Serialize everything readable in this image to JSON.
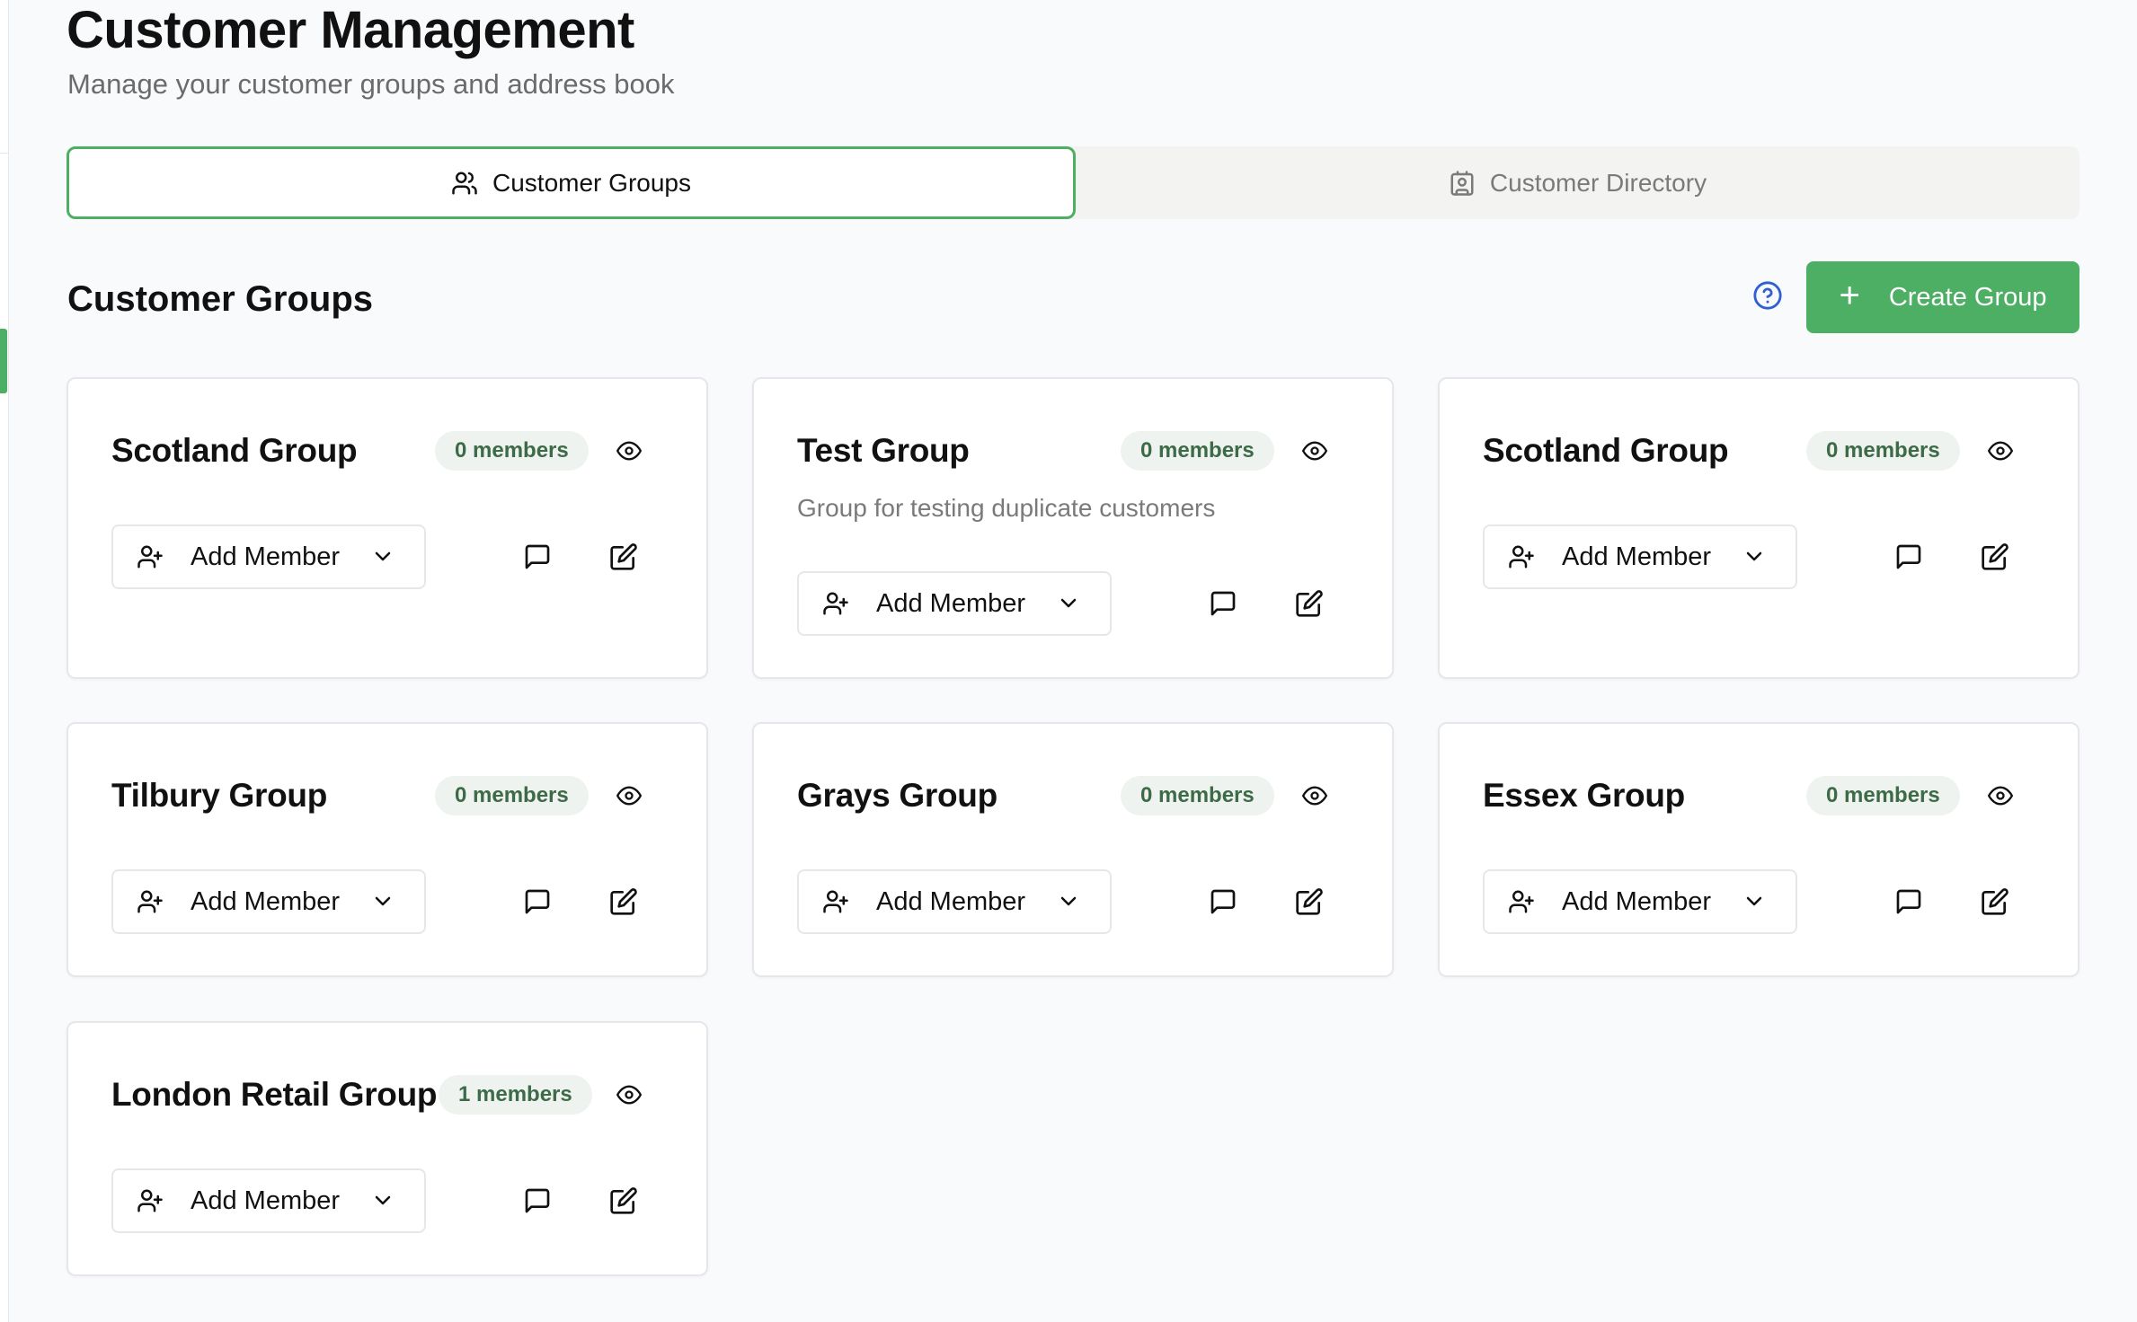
{
  "page": {
    "title": "Customer Management",
    "subtitle": "Manage your customer groups and address book"
  },
  "tabs": [
    {
      "label": "Customer Groups",
      "icon": "users-icon",
      "active": true
    },
    {
      "label": "Customer Directory",
      "icon": "contact-icon",
      "active": false
    }
  ],
  "section": {
    "title": "Customer Groups",
    "help_icon": "help-circle-icon",
    "create_button": "Create Group"
  },
  "groups": [
    {
      "name": "Scotland Group",
      "members": "0 members",
      "description": "",
      "add_member": "Add Member"
    },
    {
      "name": "Test Group",
      "members": "0 members",
      "description": "Group for testing duplicate customers",
      "add_member": "Add Member"
    },
    {
      "name": "Scotland Group",
      "members": "0 members",
      "description": "",
      "add_member": "Add Member"
    },
    {
      "name": "Tilbury Group",
      "members": "0 members",
      "description": "",
      "add_member": "Add Member"
    },
    {
      "name": "Grays Group",
      "members": "0 members",
      "description": "",
      "add_member": "Add Member"
    },
    {
      "name": "Essex Group",
      "members": "0 members",
      "description": "",
      "add_member": "Add Member"
    },
    {
      "name": "London Retail Group",
      "members": "1 members",
      "description": "",
      "add_member": "Add Member"
    }
  ],
  "colors": {
    "accent": "#4caf64",
    "badge_bg": "#eef3ef",
    "badge_text": "#3d6b48",
    "help_icon": "#2f5fd0"
  }
}
